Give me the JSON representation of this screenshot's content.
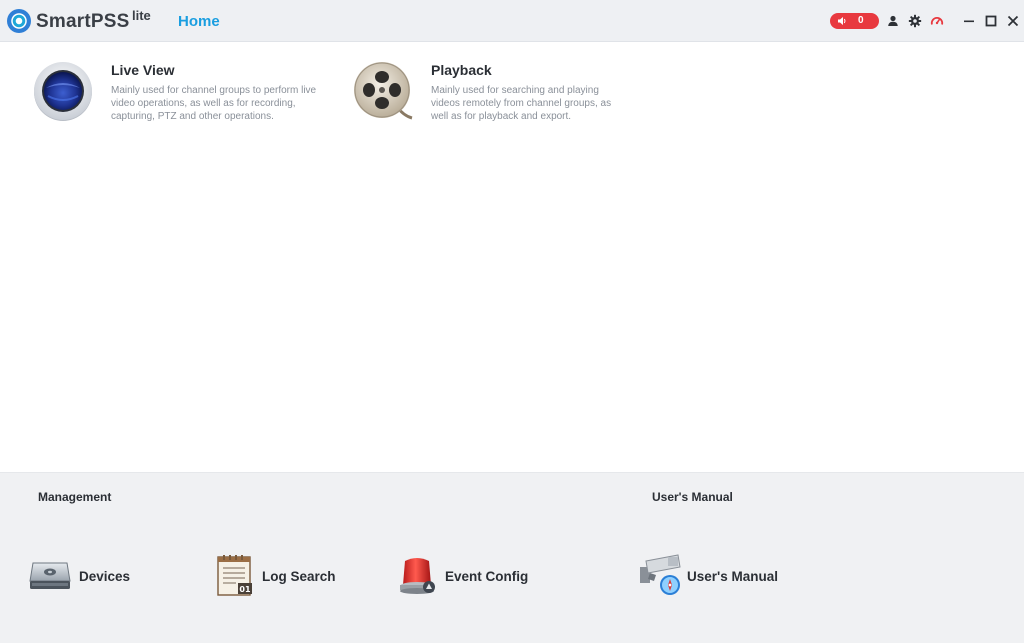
{
  "app": {
    "brand": "SmartPSS",
    "brand_sup": "lite",
    "active_tab": "Home"
  },
  "toolbar": {
    "alarm_count": "0",
    "icons": [
      "speaker-icon",
      "user-icon",
      "gear-icon",
      "performance-gauge-icon"
    ],
    "window_controls": [
      "minimize-icon",
      "maximize-icon",
      "close-icon"
    ]
  },
  "features": [
    {
      "title": "Live View",
      "description": "Mainly used for channel groups to perform live video operations, as well as for recording, capturing, PTZ and other operations."
    },
    {
      "title": "Playback",
      "description": "Mainly used for searching and playing videos remotely from channel groups, as well as for playback and export."
    }
  ],
  "management": {
    "title": "Management",
    "items": [
      {
        "label": "Devices",
        "icon": "device-drive-icon"
      },
      {
        "label": "Log Search",
        "icon": "log-document-icon"
      },
      {
        "label": "Event Config",
        "icon": "alarm-siren-icon"
      }
    ]
  },
  "manual": {
    "title": "User's Manual",
    "items": [
      {
        "label": "User's Manual",
        "icon": "camera-manual-icon"
      }
    ]
  },
  "colors": {
    "accent": "#1a9ee0",
    "alarm": "#e8393f",
    "titlebar_bg": "#eef0f3",
    "panel_bg": "#f0f1f3"
  }
}
